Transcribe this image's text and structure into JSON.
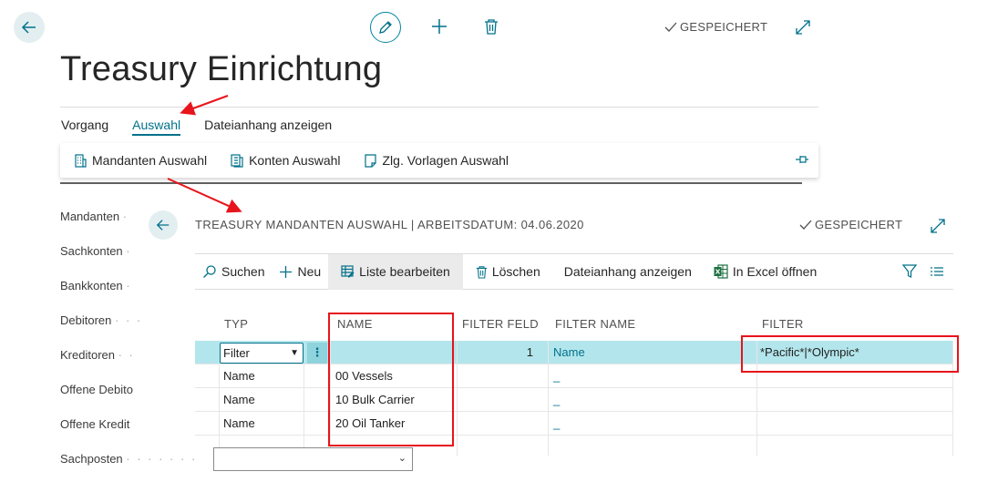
{
  "header": {
    "saved_label": "GESPEICHERT",
    "title": "Treasury Einrichtung"
  },
  "tabs": [
    "Vorgang",
    "Auswahl",
    "Dateianhang anzeigen"
  ],
  "action_pane": {
    "items": [
      "Mandanten Auswahl",
      "Konten Auswahl",
      "Zlg. Vorlagen Auswahl"
    ]
  },
  "nav": {
    "items": [
      "Mandanten",
      "Sachkonten",
      "Bankkonten",
      "Debitoren",
      "Kreditoren",
      "Offene Debito",
      "Offene Kredit",
      "Sachposten"
    ]
  },
  "subpage": {
    "title": "TREASURY MANDANTEN AUSWAHL | ARBEITSDATUM: 04.06.2020",
    "saved_label": "GESPEICHERT",
    "toolbar": {
      "search": "Suchen",
      "new": "Neu",
      "edit_list": "Liste bearbeiten",
      "delete": "Löschen",
      "attachments": "Dateianhang anzeigen",
      "excel": "In Excel öffnen"
    },
    "columns": [
      "TYP",
      "NAME",
      "FILTER FELD",
      "FILTER NAME",
      "FILTER"
    ],
    "rows": [
      {
        "typ": "Filter",
        "name": "",
        "filter_feld": "1",
        "filter_name": "Name",
        "filter": "*Pacific*|*Olympic*"
      },
      {
        "typ": "Name",
        "name": "00 Vessels",
        "filter_feld": "",
        "filter_name": "_",
        "filter": ""
      },
      {
        "typ": "Name",
        "name": "10 Bulk Carrier",
        "filter_feld": "",
        "filter_name": "_",
        "filter": ""
      },
      {
        "typ": "Name",
        "name": "20 Oil Tanker",
        "filter_feld": "",
        "filter_name": "_",
        "filter": ""
      }
    ]
  },
  "colors": {
    "accent": "#00718a",
    "selected_row": "#b3e6ec",
    "annotation_red": "#e8141b"
  }
}
